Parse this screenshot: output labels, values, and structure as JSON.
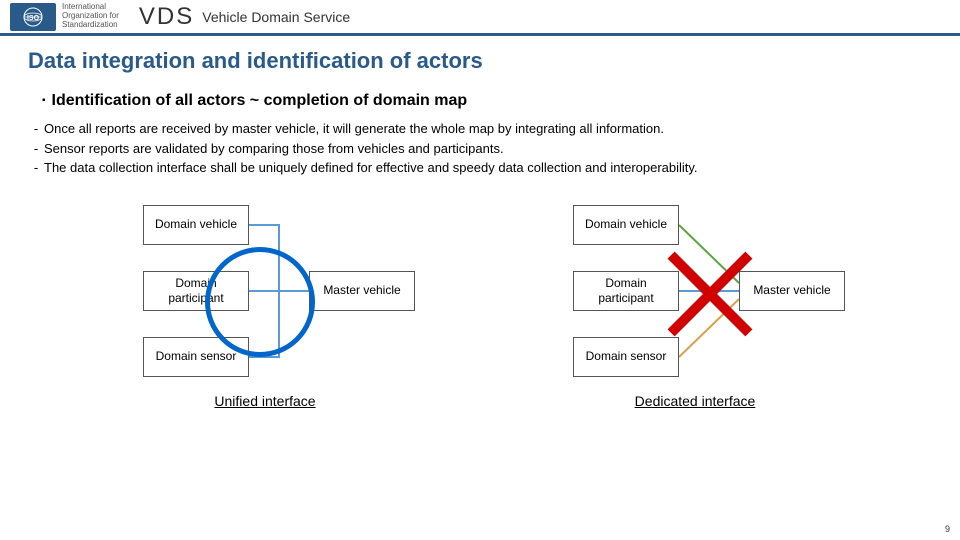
{
  "iso_text_1": "International",
  "iso_text_2": "Organization for",
  "iso_text_3": "Standardization",
  "vds_label": "VDS",
  "vds_subtitle": "Vehicle Domain Service",
  "title": "Data integration and identification of actors",
  "sub_heading": "Identification of all actors ~ completion of domain map",
  "bullets": {
    "b1": "Once all reports are received by master vehicle, it will generate the whole map by integrating all information.",
    "b2": "Sensor reports are validated by comparing those from vehicles and participants.",
    "b3": "The data collection interface shall be uniquely defined for effective and speedy data collection and interoperability."
  },
  "box_labels": {
    "domain_vehicle": "Domain vehicle",
    "domain_participant": "Domain participant",
    "domain_sensor": "Domain sensor",
    "master_vehicle": "Master vehicle"
  },
  "captions": {
    "left": "Unified interface",
    "right": "Dedicated interface"
  },
  "page_num": "9",
  "colors": {
    "circle": "#0066cc",
    "x": "#d00000",
    "line_green": "#5aa63c",
    "line_blue": "#5a9bd5",
    "line_orange": "#d7a24a"
  }
}
